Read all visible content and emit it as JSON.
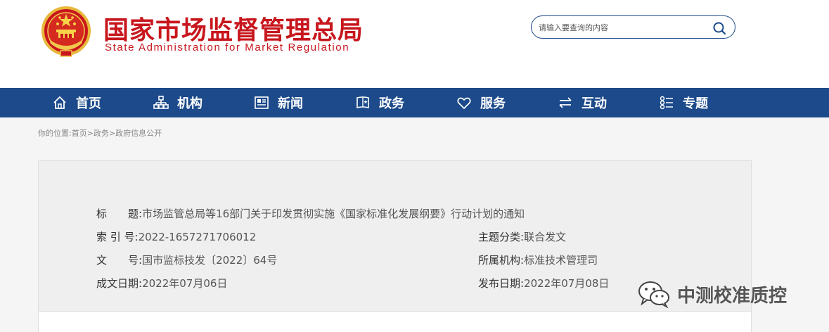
{
  "header": {
    "title_cn": "国家市场监督管理总局",
    "title_en": "State Administration for Market Regulation",
    "search_placeholder": "请输入要查询的内容"
  },
  "nav": {
    "items": [
      {
        "label": "首页",
        "icon": "home-icon"
      },
      {
        "label": "机构",
        "icon": "org-chart-icon"
      },
      {
        "label": "新闻",
        "icon": "news-icon"
      },
      {
        "label": "政务",
        "icon": "government-affairs-icon"
      },
      {
        "label": "服务",
        "icon": "heart-icon"
      },
      {
        "label": "互动",
        "icon": "exchange-icon"
      },
      {
        "label": "专题",
        "icon": "topics-icon"
      }
    ]
  },
  "breadcrumb": {
    "prefix": "你的位置:",
    "items": [
      "首页",
      "政务",
      "政府信息公开"
    ],
    "separator": ">"
  },
  "info": {
    "title_label": "标　　题:",
    "title_value": "市场监管总局等16部门关于印发贯彻实施《国家标准化发展纲要》行动计划的通知",
    "index_label": "索 引 号:",
    "index_value": "2022-1657271706012",
    "category_label": "主题分类:",
    "category_value": "联合发文",
    "doc_no_label": "文　　号:",
    "doc_no_value": "国市监标技发〔2022〕64号",
    "org_label": "所属机构:",
    "org_value": "标准技术管理司",
    "created_label": "成文日期:",
    "created_value": "2022年07月06日",
    "published_label": "发布日期:",
    "published_value": "2022年07月08日"
  },
  "watermark": {
    "text": "中测校准质控",
    "icon": "wechat-icon"
  },
  "colors": {
    "brand_red": "#c8161d",
    "nav_blue": "#1c4a8a",
    "panel_bg": "#efefef"
  }
}
